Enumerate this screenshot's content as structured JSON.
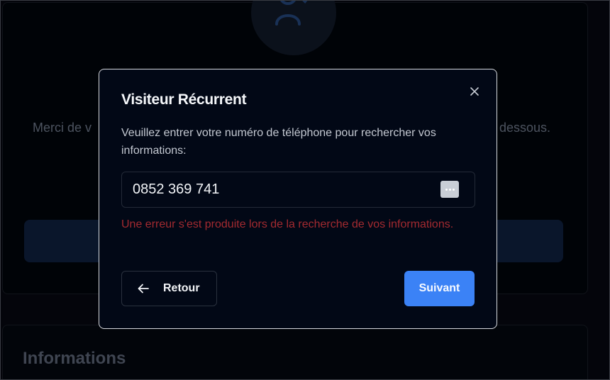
{
  "background": {
    "text_left": "Merci de v",
    "text_right": "dessous.",
    "section_title": "Informations"
  },
  "dialog": {
    "title": "Visiteur Récurrent",
    "description": "Veuillez entrer votre numéro de téléphone pour rechercher vos informations:",
    "phone_value": "0852 369 741",
    "error_message": "Une erreur s'est produite lors de la recherche de vos informations.",
    "back_label": "Retour",
    "next_label": "Suivant"
  },
  "icons": {
    "close": "close-icon",
    "back": "arrow-left-icon",
    "autofill": "autofill-dots-icon",
    "avatar": "user-check-icon"
  },
  "colors": {
    "accent": "#3b82f6",
    "error": "#a32a30",
    "dialog_bg": "#020816"
  }
}
